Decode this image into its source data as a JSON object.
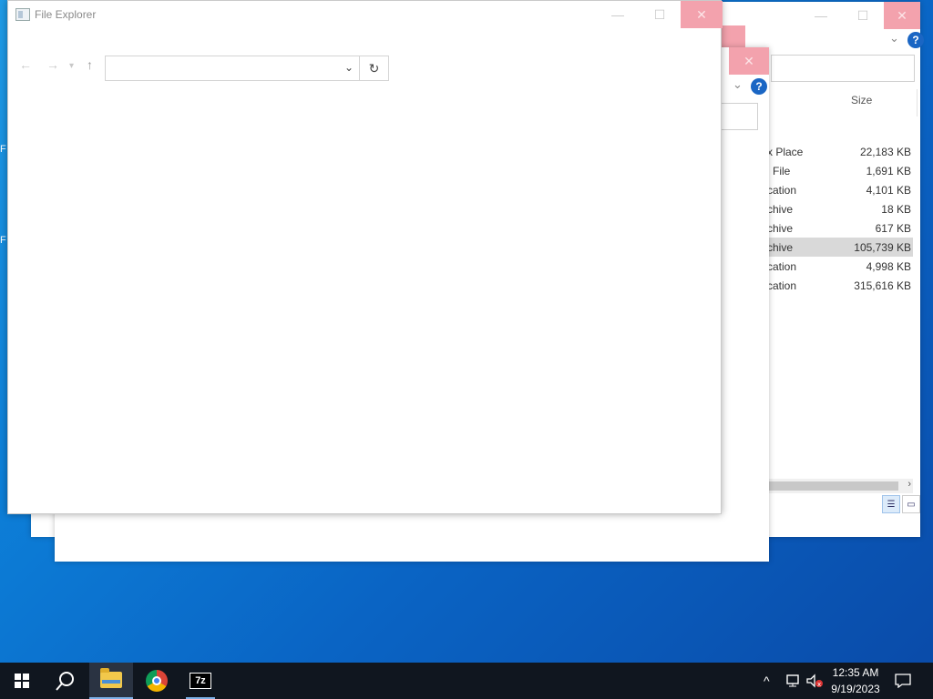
{
  "front_window": {
    "title": "File Explorer",
    "minimize_glyph": "—",
    "maximize_glyph": "☐",
    "close_glyph": "✕",
    "nav": {
      "back_glyph": "←",
      "forward_glyph": "→",
      "recent_glyph": "▾",
      "up_glyph": "↑"
    },
    "address": {
      "value": "",
      "dropdown_glyph": "⌄"
    },
    "refresh_glyph": "↻"
  },
  "back_window": {
    "minimize_glyph": "—",
    "maximize_glyph": "☐",
    "close_glyph": "✕",
    "ribbon_expand_glyph": "⌄",
    "help_glyph": "?",
    "column_size": "Size",
    "rows": [
      {
        "type": "x Place",
        "size": "22,183 KB",
        "selected": false
      },
      {
        "type": "l File",
        "size": "1,691 KB",
        "selected": false
      },
      {
        "type": "cation",
        "size": "4,101 KB",
        "selected": false
      },
      {
        "type": "chive",
        "size": "18 KB",
        "selected": false
      },
      {
        "type": "chive",
        "size": "617 KB",
        "selected": false
      },
      {
        "type": "chive",
        "size": "105,739 KB",
        "selected": true
      },
      {
        "type": "cation",
        "size": "4,998 KB",
        "selected": false
      },
      {
        "type": "cation",
        "size": "315,616 KB",
        "selected": false
      }
    ],
    "scroll_right_glyph": "›"
  },
  "middle_window": {
    "close_glyph": "✕",
    "ribbon_expand_glyph": "⌄",
    "help_glyph": "?"
  },
  "taskbar": {
    "apps": [
      {
        "name": "File Explorer",
        "active": true
      },
      {
        "name": "Google Chrome",
        "active": false
      },
      {
        "name": "7-Zip",
        "label": "7z",
        "active": false
      }
    ],
    "clock_time": "12:35 AM",
    "clock_date": "9/19/2023",
    "tray_chevron": "^"
  },
  "desktop": {
    "edge_letters": [
      "F",
      "F"
    ]
  },
  "colors": {
    "close_hover": "#f3a2ad",
    "taskbar": "#10161f",
    "accent": "#1a66c4"
  }
}
